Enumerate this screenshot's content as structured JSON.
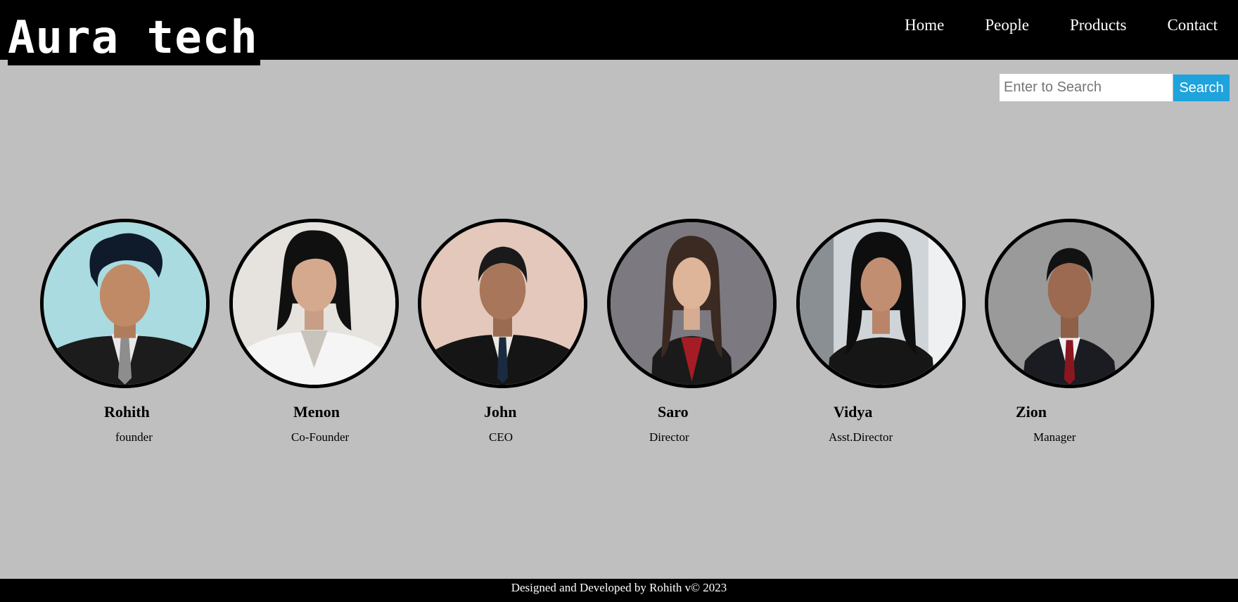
{
  "header": {
    "logo": "Aura tech",
    "nav": [
      "Home",
      "People",
      "Products",
      "Contact"
    ]
  },
  "search": {
    "placeholder": "Enter to Search",
    "button_label": "Search"
  },
  "people": [
    {
      "name": "Rohith",
      "role": "founder"
    },
    {
      "name": "Menon",
      "role": "Co-Founder"
    },
    {
      "name": "John",
      "role": "CEO"
    },
    {
      "name": "Saro",
      "role": "Director"
    },
    {
      "name": "Vidya",
      "role": "Asst.Director"
    },
    {
      "name": "Zion",
      "role": "Manager"
    }
  ],
  "footer": {
    "text": "Designed and Developed by Rohith v© 2023"
  },
  "colors": {
    "header_bg": "#000000",
    "page_bg": "#bfbfbf",
    "search_button": "#1fa3dc"
  }
}
